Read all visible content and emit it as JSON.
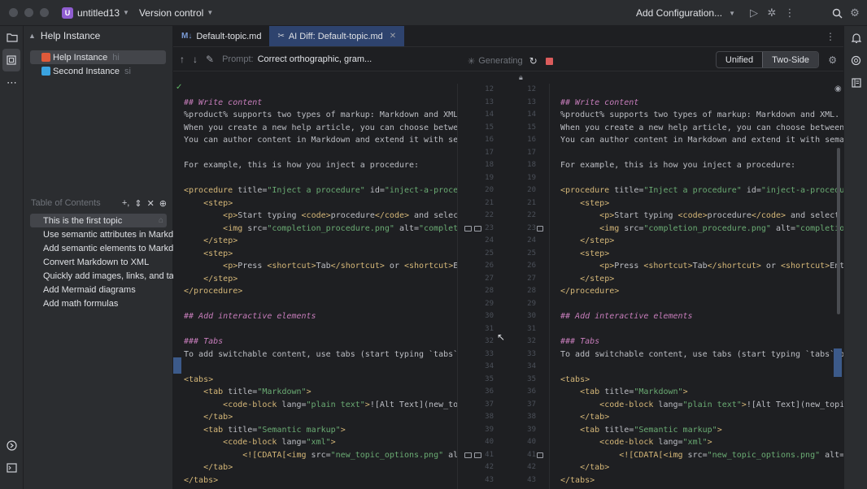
{
  "titlebar": {
    "project_badge": "U",
    "project_name": "untitled13",
    "vcs_label": "Version control",
    "run_config": "Add Configuration..."
  },
  "side": {
    "header": "Help Instance",
    "instances": [
      {
        "label": "Help Instance",
        "tag": "hi",
        "color": "#e05a3a"
      },
      {
        "label": "Second Instance",
        "tag": "si",
        "color": "#3aa3e0"
      }
    ],
    "toc_header": "Table of Contents",
    "toc": [
      "This is the first topic",
      "Use semantic attributes in Markdown",
      "Add semantic elements to Markdown",
      "Convert Markdown to XML",
      "Quickly add images, links, and tables",
      "Add Mermaid diagrams",
      "Add math formulas"
    ]
  },
  "tabs": [
    {
      "label": "Default-topic.md",
      "icon": "M↓"
    },
    {
      "label": "AI Diff: Default-topic.md",
      "icon": "✂"
    }
  ],
  "toolbar": {
    "prompt_label": "Prompt:",
    "prompt_text": "Correct orthographic, gram...",
    "status": "Generating",
    "view_unified": "Unified",
    "view_two_side": "Two-Side"
  },
  "line_numbers_left": [
    "12",
    "13",
    "14",
    "15",
    "16",
    "17",
    "18",
    "19",
    "20",
    "21",
    "22",
    "23",
    "24",
    "25",
    "26",
    "27",
    "28",
    "29",
    "30",
    "31",
    "32",
    "33",
    "34",
    "35",
    "36",
    "37",
    "38",
    "39",
    "40",
    "41",
    "42",
    "43"
  ],
  "line_numbers_right": [
    "12",
    "13",
    "14",
    "15",
    "16",
    "17",
    "18",
    "19",
    "20",
    "21",
    "22",
    "23",
    "24",
    "25",
    "26",
    "27",
    "28",
    "29",
    "30",
    "31",
    "32",
    "33",
    "34",
    "35",
    "36",
    "37",
    "38",
    "39",
    "40",
    "41",
    "42",
    "43"
  ],
  "left_lines": [
    "",
    "## Write content",
    "%product% supports two types of markup: Markdown and XML.",
    "When you create a new help article, you can choose between tw",
    "You can author content in Markdown and extend it with semanti",
    "",
    "For example, this is how you inject a procedure:",
    "",
    "<procedure title=\"Inject a procedure\" id=\"inject-a-procedure\"",
    "    <step>",
    "        <p>Start typing <code>procedure</code> and select a p",
    "        <img src=\"completion_procedure.png\" alt=\"completion s",
    "    </step>",
    "    <step>",
    "        <p>Press <shortcut>Tab</shortcut> or <shortcut>Enter<",
    "    </step>",
    "</procedure>",
    "",
    "## Add interactive elements",
    "",
    "### Tabs",
    "To add switchable content, use tabs (start typing `tabs` on a",
    "",
    "<tabs>",
    "    <tab title=\"Markdown\">",
    "        <code-block lang=\"plain text\">![Alt Text](new_topic_o",
    "    </tab>",
    "    <tab title=\"Semantic markup\">",
    "        <code-block lang=\"xml\">",
    "            <![CDATA[<img src=\"new_topic_options.png\" alt=\"Al",
    "    </tab>",
    "</tabs>"
  ],
  "right_lines": [
    "",
    "## Write content",
    "%product% supports two types of markup: Markdown and XML.",
    "When you create a new help article, you can choose between two to",
    "You can author content in Markdown and extend it with semantic at",
    "",
    "For example, this is how you inject a procedure:",
    "",
    "<procedure title=\"Inject a procedure\" id=\"inject-a-procedure\">",
    "    <step>",
    "        <p>Start typing <code>procedure</code> and select a proce",
    "        <img src=\"completion_procedure.png\" alt=\"completion sugge",
    "    </step>",
    "    <step>",
    "        <p>Press <shortcut>Tab</shortcut> or <shortcut>Enter</sho",
    "    </step>",
    "</procedure>",
    "",
    "## Add interactive elements",
    "",
    "### Tabs",
    "To add switchable content, use tabs (start typing `tabs` on a ne",
    "",
    "<tabs>",
    "    <tab title=\"Markdown\">",
    "        <code-block lang=\"plain text\">![Alt Text](new_topic_optio",
    "    </tab>",
    "    <tab title=\"Semantic markup\">",
    "        <code-block lang=\"xml\">",
    "            <![CDATA[<img src=\"new_topic_options.png\" alt=\"Alt te",
    "    </tab>",
    "</tabs>"
  ],
  "icons": {
    "folder": "folder-icon",
    "structure": "structure-icon",
    "more": "more-icon",
    "search": "search-icon",
    "settings": "gear-icon"
  }
}
